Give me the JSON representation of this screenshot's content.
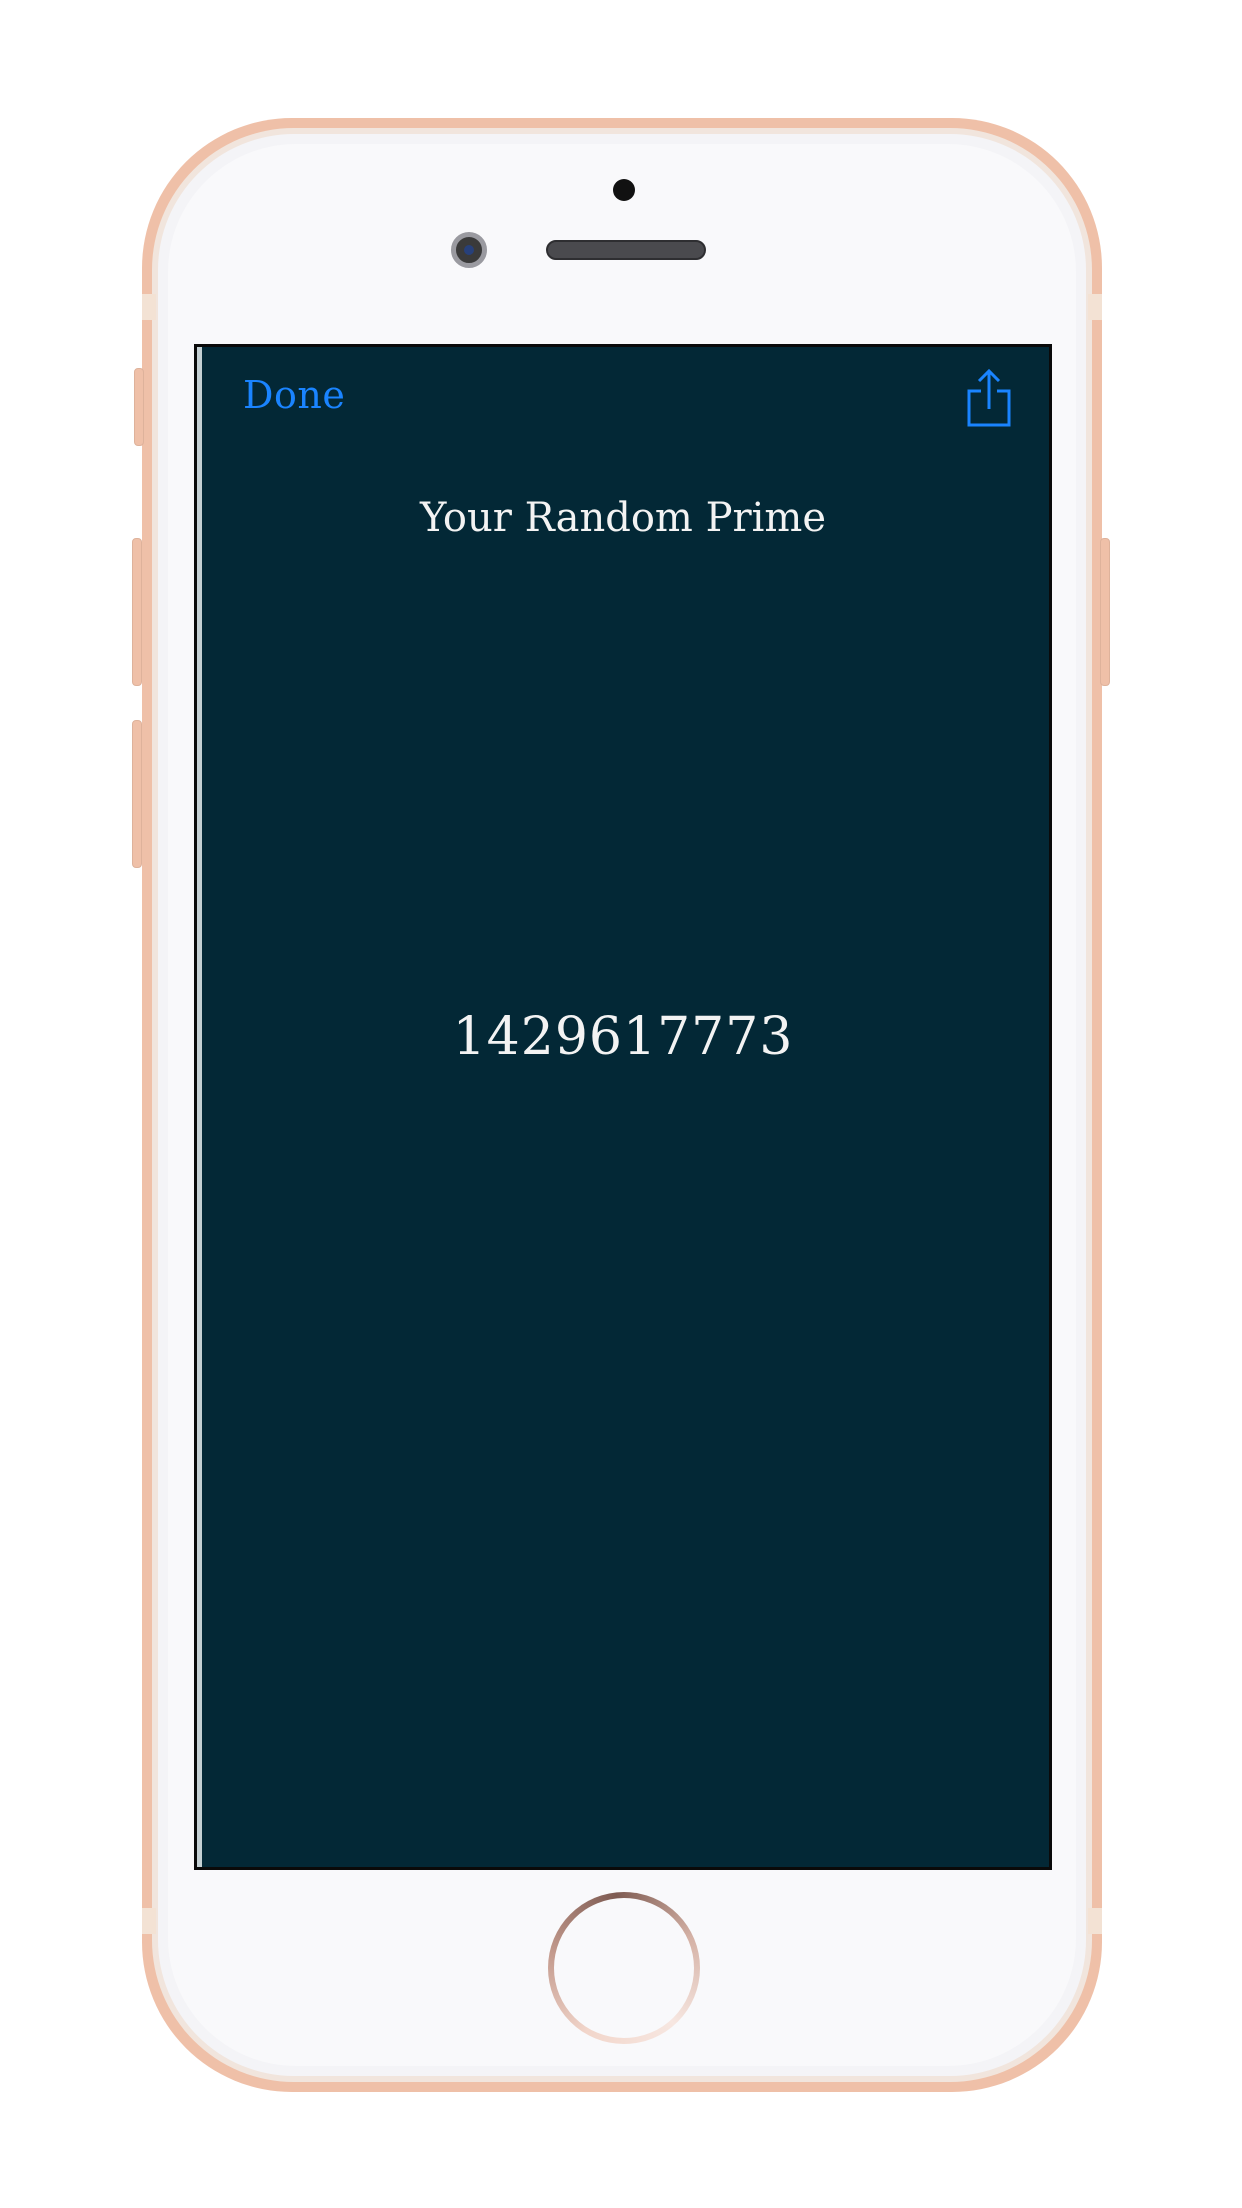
{
  "device": {
    "frame_color": "#efc0a8",
    "face_color": "#f9f9fb"
  },
  "app": {
    "background_color": "#032836",
    "accent_color": "#1a84ff",
    "text_color": "#f3f3f3",
    "toolbar": {
      "done_label": "Done",
      "share_icon": "share-icon"
    },
    "title": "Your Random Prime",
    "prime_value": "1429617773"
  }
}
